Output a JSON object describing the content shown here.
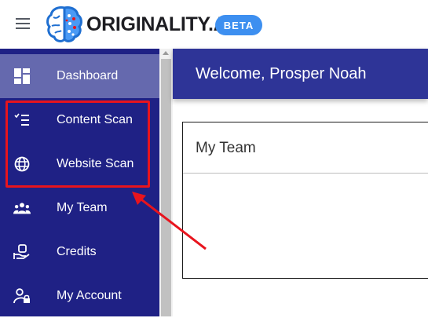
{
  "header": {
    "brand": "ORIGINALITY.AI",
    "badge": "BETA",
    "menu_icon": "hamburger-menu-icon",
    "logo_icon": "brain-logo-icon"
  },
  "sidebar": {
    "items": [
      {
        "label": "Dashboard",
        "icon": "dashboard-icon",
        "active": true
      },
      {
        "label": "Content Scan",
        "icon": "checklist-icon",
        "active": false
      },
      {
        "label": "Website Scan",
        "icon": "globe-icon",
        "active": false
      },
      {
        "label": "My Team",
        "icon": "team-icon",
        "active": false
      },
      {
        "label": "Credits",
        "icon": "credits-icon",
        "active": false
      },
      {
        "label": "My Account",
        "icon": "account-lock-icon",
        "active": false
      }
    ]
  },
  "main": {
    "welcome": "Welcome, Prosper Noah",
    "card_title": "My Team"
  },
  "colors": {
    "sidebar_bg": "#1f2185",
    "sidebar_active": "#6569ae",
    "welcome_bar": "#2e3497",
    "badge": "#3d8ff0",
    "annotation": "#e8141d"
  }
}
